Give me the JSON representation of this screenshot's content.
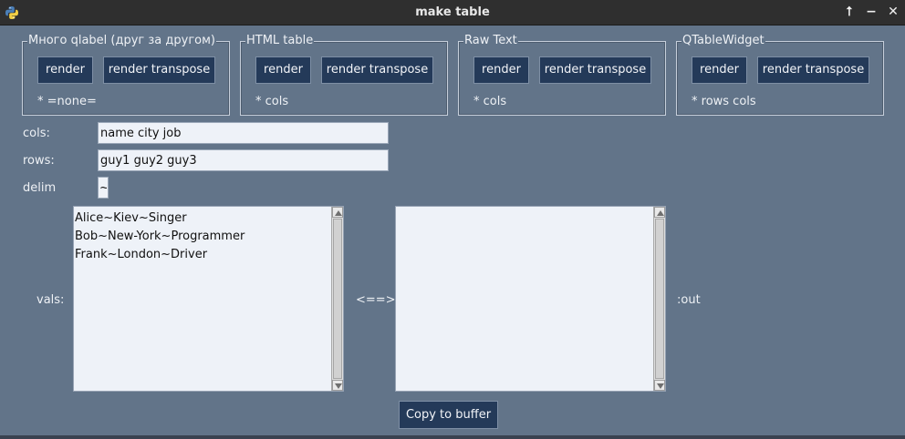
{
  "window": {
    "title": "make table",
    "buttons": {
      "keep_above": "⭡",
      "minimize": "−",
      "close": "✕"
    }
  },
  "groups": [
    {
      "title": "Много qlabel (друг за другом)",
      "render_label": "render",
      "transpose_label": "render transpose",
      "note": "* =none="
    },
    {
      "title": "HTML table",
      "render_label": "render",
      "transpose_label": "render transpose",
      "note": "* cols"
    },
    {
      "title": "Raw Text",
      "render_label": "render",
      "transpose_label": "render transpose",
      "note": "* cols"
    },
    {
      "title": "QTableWidget",
      "render_label": "render",
      "transpose_label": "render transpose",
      "note": "* rows cols"
    }
  ],
  "form": {
    "cols_label": "cols:",
    "cols_value": "name city job",
    "rows_label": "rows:",
    "rows_value": "guy1 guy2 guy3",
    "delim_label": "delim",
    "delim_value": "~",
    "vals_label": "vals:",
    "vals_lines": [
      "Alice~Kiev~Singer",
      "Bob~New-York~Programmer",
      "Frank~London~Driver"
    ],
    "swap_label": "<==>",
    "out_label": ":out",
    "copy_button": "Copy to buffer"
  },
  "colors": {
    "background": "#627489",
    "button_bg": "#243a59",
    "field_bg": "#eef2f8",
    "titlebar_bg": "#2f2f2f"
  }
}
